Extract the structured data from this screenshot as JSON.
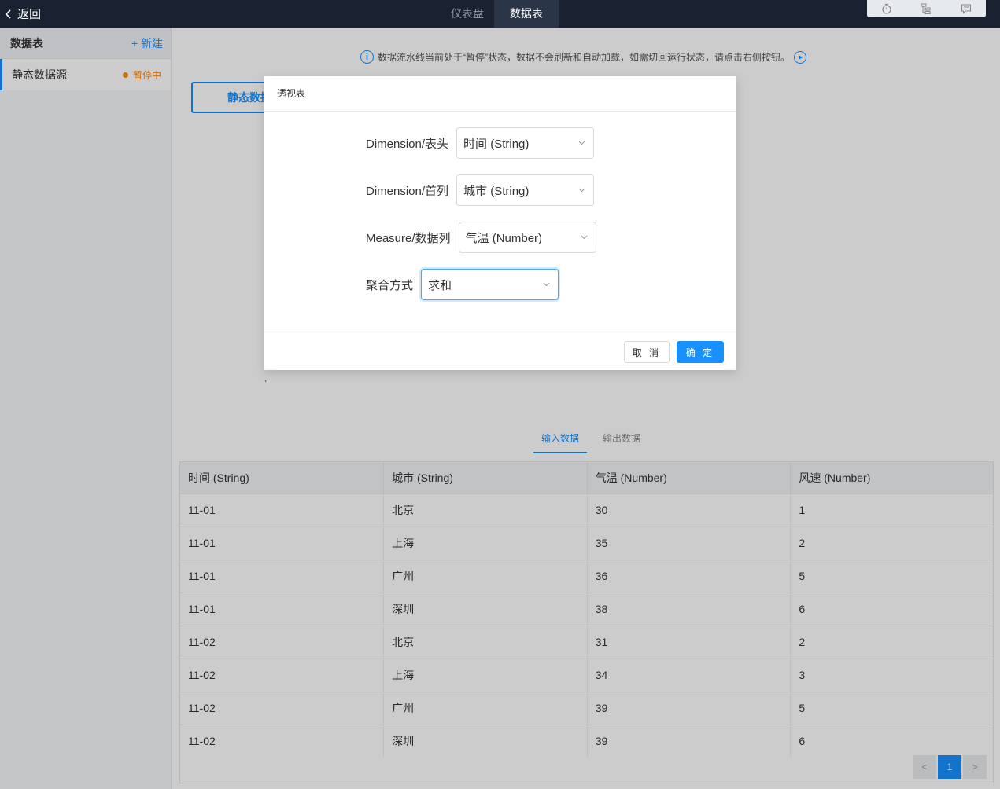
{
  "topbar": {
    "back_label": "返回",
    "tabs": [
      "仪表盘",
      "数据表"
    ],
    "tools": [
      "timer-icon",
      "tree-icon",
      "comment-icon"
    ]
  },
  "sidebar": {
    "title": "数据表",
    "new_label": "+ 新建",
    "items": [
      {
        "label": "静态数据源",
        "status": "暂停中"
      }
    ]
  },
  "main": {
    "notice": "数据流水线当前处于“暂停”状态，数据不会刷新和自动加载，如需切回运行状态，请点击右侧按钮。",
    "static_button": "静态数据",
    "comma": ",",
    "data_tabs": [
      "输入数据",
      "输出数据"
    ],
    "table": {
      "columns": [
        "时间 (String)",
        "城市 (String)",
        "气温 (Number)",
        "风速 (Number)"
      ],
      "rows": [
        [
          "11-01",
          "北京",
          "30",
          "1"
        ],
        [
          "11-01",
          "上海",
          "35",
          "2"
        ],
        [
          "11-01",
          "广州",
          "36",
          "5"
        ],
        [
          "11-01",
          "深圳",
          "38",
          "6"
        ],
        [
          "11-02",
          "北京",
          "31",
          "2"
        ],
        [
          "11-02",
          "上海",
          "34",
          "3"
        ],
        [
          "11-02",
          "广州",
          "39",
          "5"
        ],
        [
          "11-02",
          "深圳",
          "39",
          "6"
        ]
      ]
    },
    "pagination": {
      "prev": "<",
      "current": "1",
      "next": ">"
    }
  },
  "modal": {
    "title": "透视表",
    "fields": [
      {
        "label": "Dimension/表头",
        "value": "时间 (String)"
      },
      {
        "label": "Dimension/首列",
        "value": "城市 (String)"
      },
      {
        "label": "Measure/数据列",
        "value": "气温 (Number)"
      },
      {
        "label": "聚合方式",
        "value": "求和"
      }
    ],
    "cancel": "取 消",
    "ok": "确 定"
  },
  "colors": {
    "accent": "#1890ff",
    "topbar": "#1a2232",
    "warning": "#fa8c16"
  }
}
